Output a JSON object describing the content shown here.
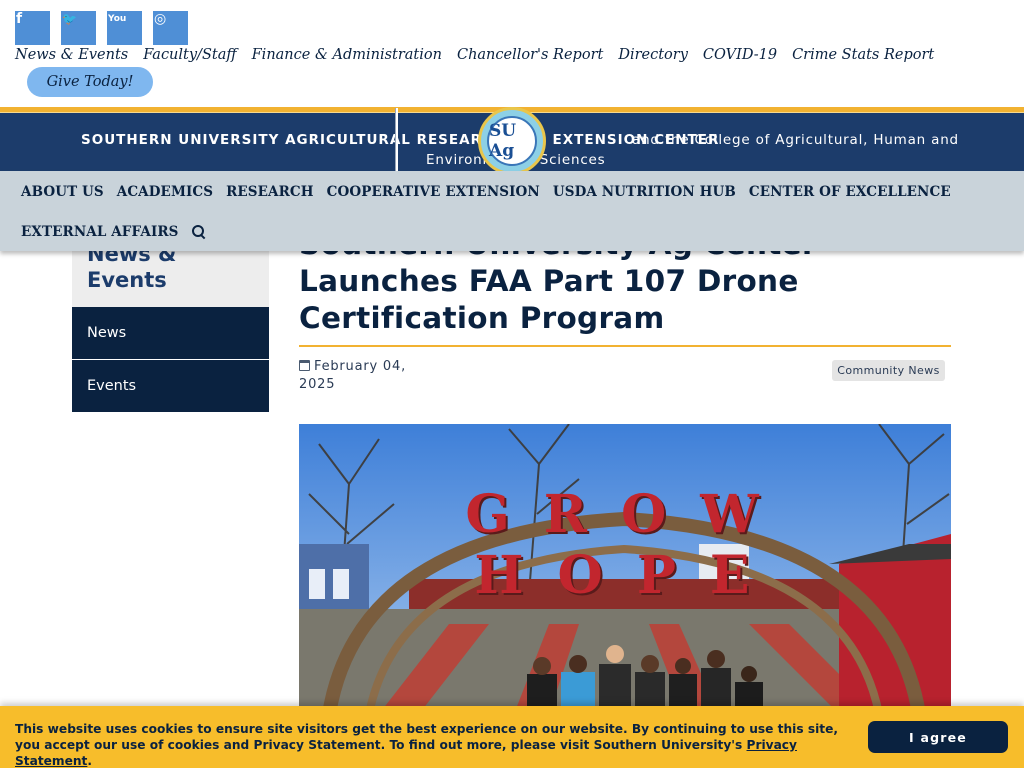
{
  "social": [
    {
      "icon": "facebook-icon",
      "glyph": "f"
    },
    {
      "icon": "twitter-icon",
      "glyph": "🐦"
    },
    {
      "icon": "youtube-icon",
      "glyph": "You"
    },
    {
      "icon": "instagram-icon",
      "glyph": "◎"
    }
  ],
  "topnav": {
    "items": [
      "News & Events",
      "Faculty/Staff",
      "Finance & Administration",
      "Chancellor's Report",
      "Directory",
      "COVID-19",
      "Crime Stats Report"
    ]
  },
  "give_label": "Give Today!",
  "header": {
    "line1_bold": "SOUTHERN UNIVERSITY AGRICULTURAL RESEARCH AND EXTENSION CENTER",
    "line1_rest": "and the College of Agricultural, Human and",
    "line2": "Environmental Sciences",
    "logo_text": "SU Ag"
  },
  "mainnav": {
    "items": [
      "ABOUT US",
      "ACADEMICS",
      "RESEARCH",
      "COOPERATIVE EXTENSION",
      "USDA NUTRITION HUB",
      "CENTER OF EXCELLENCE",
      "EXTERNAL AFFAIRS"
    ]
  },
  "sidebar": {
    "title": "News & Events",
    "items": [
      "News",
      "Events"
    ]
  },
  "article": {
    "title": "Southern University Ag Center Launches FAA Part 107 Drone Certification Program",
    "date": "February 04, 2025",
    "tag": "Community News",
    "sign_text": "GROW HOPE"
  },
  "cookie": {
    "text": "This website uses cookies to ensure site visitors get the best experience on our website. By continuing to use this site, you accept our use of cookies and Privacy Statement. To find out more, please visit Southern University's ",
    "link": "Privacy Statement",
    "end": ".",
    "button": "I agree"
  },
  "colors": {
    "navy": "#0a2240",
    "header_blue": "#1c3c6b",
    "gold": "#f2b231",
    "nav_gray": "#c9d3da",
    "social_blue": "#4f8fd6",
    "cookie_yellow": "#f7bd2b"
  }
}
